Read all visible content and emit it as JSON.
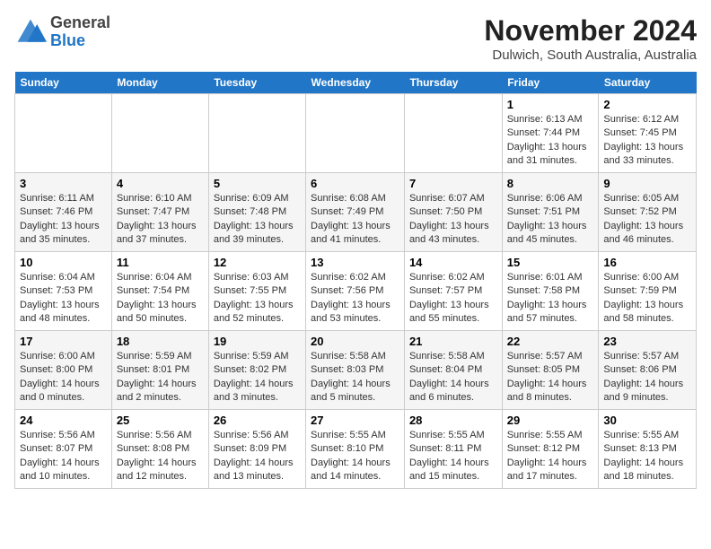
{
  "header": {
    "logo": {
      "general": "General",
      "blue": "Blue"
    },
    "month": "November 2024",
    "location": "Dulwich, South Australia, Australia"
  },
  "weekdays": [
    "Sunday",
    "Monday",
    "Tuesday",
    "Wednesday",
    "Thursday",
    "Friday",
    "Saturday"
  ],
  "weeks": [
    [
      {
        "day": null
      },
      {
        "day": null
      },
      {
        "day": null
      },
      {
        "day": null
      },
      {
        "day": null
      },
      {
        "day": "1",
        "sunrise": "6:13 AM",
        "sunset": "7:44 PM",
        "daylight": "13 hours and 31 minutes."
      },
      {
        "day": "2",
        "sunrise": "6:12 AM",
        "sunset": "7:45 PM",
        "daylight": "13 hours and 33 minutes."
      }
    ],
    [
      {
        "day": "3",
        "sunrise": "6:11 AM",
        "sunset": "7:46 PM",
        "daylight": "13 hours and 35 minutes."
      },
      {
        "day": "4",
        "sunrise": "6:10 AM",
        "sunset": "7:47 PM",
        "daylight": "13 hours and 37 minutes."
      },
      {
        "day": "5",
        "sunrise": "6:09 AM",
        "sunset": "7:48 PM",
        "daylight": "13 hours and 39 minutes."
      },
      {
        "day": "6",
        "sunrise": "6:08 AM",
        "sunset": "7:49 PM",
        "daylight": "13 hours and 41 minutes."
      },
      {
        "day": "7",
        "sunrise": "6:07 AM",
        "sunset": "7:50 PM",
        "daylight": "13 hours and 43 minutes."
      },
      {
        "day": "8",
        "sunrise": "6:06 AM",
        "sunset": "7:51 PM",
        "daylight": "13 hours and 45 minutes."
      },
      {
        "day": "9",
        "sunrise": "6:05 AM",
        "sunset": "7:52 PM",
        "daylight": "13 hours and 46 minutes."
      }
    ],
    [
      {
        "day": "10",
        "sunrise": "6:04 AM",
        "sunset": "7:53 PM",
        "daylight": "13 hours and 48 minutes."
      },
      {
        "day": "11",
        "sunrise": "6:04 AM",
        "sunset": "7:54 PM",
        "daylight": "13 hours and 50 minutes."
      },
      {
        "day": "12",
        "sunrise": "6:03 AM",
        "sunset": "7:55 PM",
        "daylight": "13 hours and 52 minutes."
      },
      {
        "day": "13",
        "sunrise": "6:02 AM",
        "sunset": "7:56 PM",
        "daylight": "13 hours and 53 minutes."
      },
      {
        "day": "14",
        "sunrise": "6:02 AM",
        "sunset": "7:57 PM",
        "daylight": "13 hours and 55 minutes."
      },
      {
        "day": "15",
        "sunrise": "6:01 AM",
        "sunset": "7:58 PM",
        "daylight": "13 hours and 57 minutes."
      },
      {
        "day": "16",
        "sunrise": "6:00 AM",
        "sunset": "7:59 PM",
        "daylight": "13 hours and 58 minutes."
      }
    ],
    [
      {
        "day": "17",
        "sunrise": "6:00 AM",
        "sunset": "8:00 PM",
        "daylight": "14 hours and 0 minutes."
      },
      {
        "day": "18",
        "sunrise": "5:59 AM",
        "sunset": "8:01 PM",
        "daylight": "14 hours and 2 minutes."
      },
      {
        "day": "19",
        "sunrise": "5:59 AM",
        "sunset": "8:02 PM",
        "daylight": "14 hours and 3 minutes."
      },
      {
        "day": "20",
        "sunrise": "5:58 AM",
        "sunset": "8:03 PM",
        "daylight": "14 hours and 5 minutes."
      },
      {
        "day": "21",
        "sunrise": "5:58 AM",
        "sunset": "8:04 PM",
        "daylight": "14 hours and 6 minutes."
      },
      {
        "day": "22",
        "sunrise": "5:57 AM",
        "sunset": "8:05 PM",
        "daylight": "14 hours and 8 minutes."
      },
      {
        "day": "23",
        "sunrise": "5:57 AM",
        "sunset": "8:06 PM",
        "daylight": "14 hours and 9 minutes."
      }
    ],
    [
      {
        "day": "24",
        "sunrise": "5:56 AM",
        "sunset": "8:07 PM",
        "daylight": "14 hours and 10 minutes."
      },
      {
        "day": "25",
        "sunrise": "5:56 AM",
        "sunset": "8:08 PM",
        "daylight": "14 hours and 12 minutes."
      },
      {
        "day": "26",
        "sunrise": "5:56 AM",
        "sunset": "8:09 PM",
        "daylight": "14 hours and 13 minutes."
      },
      {
        "day": "27",
        "sunrise": "5:55 AM",
        "sunset": "8:10 PM",
        "daylight": "14 hours and 14 minutes."
      },
      {
        "day": "28",
        "sunrise": "5:55 AM",
        "sunset": "8:11 PM",
        "daylight": "14 hours and 15 minutes."
      },
      {
        "day": "29",
        "sunrise": "5:55 AM",
        "sunset": "8:12 PM",
        "daylight": "14 hours and 17 minutes."
      },
      {
        "day": "30",
        "sunrise": "5:55 AM",
        "sunset": "8:13 PM",
        "daylight": "14 hours and 18 minutes."
      }
    ]
  ]
}
